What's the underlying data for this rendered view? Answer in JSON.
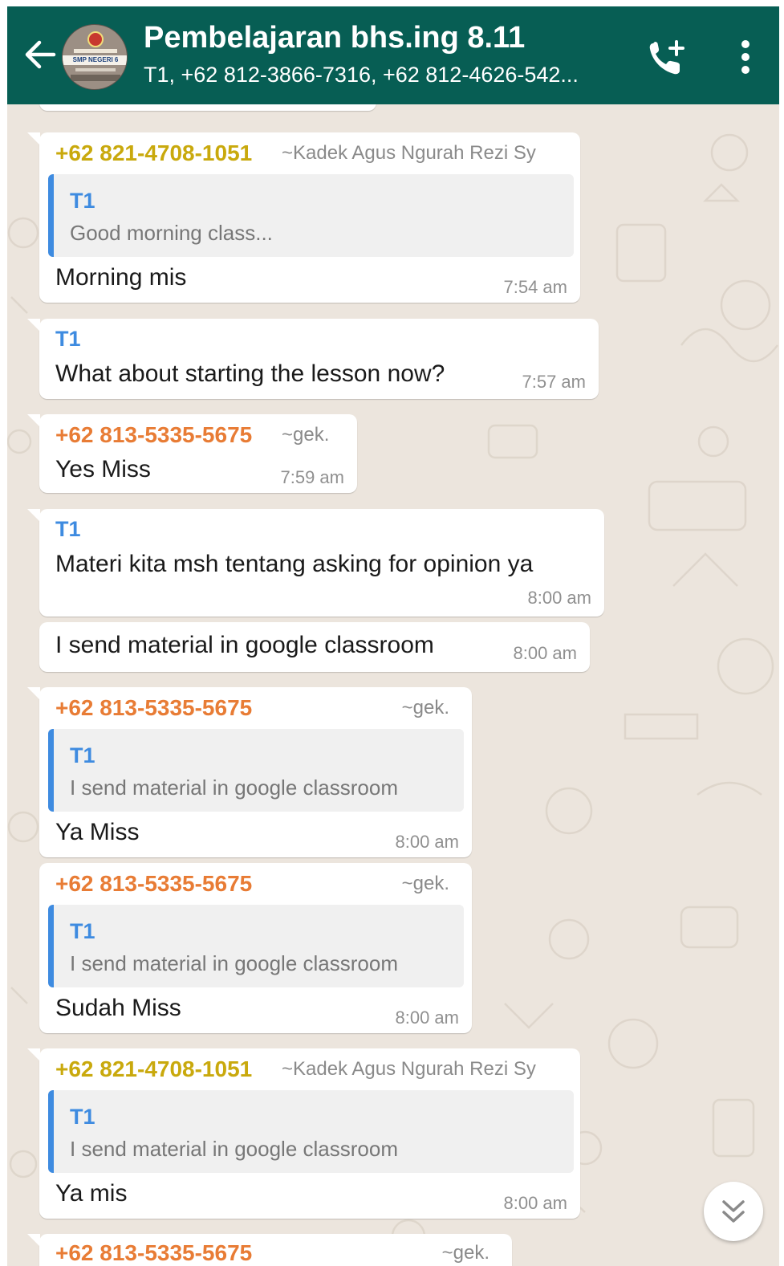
{
  "header": {
    "title": "Pembelajaran bhs.ing 8.11",
    "subtitle": "T1, +62 812-3866-7316, +62 812-4626-542...",
    "avatar_caption": "SMP NEGERI 6",
    "icons": [
      "back-arrow-icon",
      "add-call-icon",
      "more-vert-icon"
    ]
  },
  "colors": {
    "header_bg": "#075e54",
    "chat_bg": "#ece5dd",
    "quote_accent": "#3e8be0",
    "sender_orange": "#e87c35",
    "sender_yellow": "#c9a90d"
  },
  "messages": [
    {
      "sender": "+62 821-4708-1051",
      "alias": "~Kadek Agus Ngurah Rezi Sy",
      "quote": {
        "name": "T1",
        "text": "Good morning class..."
      },
      "text": "Morning mis",
      "time": "7:54 am"
    },
    {
      "name": "T1",
      "text": "What about starting the lesson now?",
      "time": "7:57 am"
    },
    {
      "sender": "+62 813-5335-5675",
      "alias": "~gek.",
      "text": "Yes Miss",
      "time": "7:59 am"
    },
    {
      "name": "T1",
      "text": "Materi kita msh tentang asking for opinion ya",
      "time": "8:00 am"
    },
    {
      "text": "I send material in google classroom",
      "time": "8:00 am"
    },
    {
      "sender": "+62 813-5335-5675",
      "alias": "~gek.",
      "quote": {
        "name": "T1",
        "text": "I send material in google classroom"
      },
      "text": "Ya Miss",
      "time": "8:00 am"
    },
    {
      "sender": "+62 813-5335-5675",
      "alias": "~gek.",
      "quote": {
        "name": "T1",
        "text": "I send material in google classroom"
      },
      "text": "Sudah Miss",
      "time": "8:00 am"
    },
    {
      "sender": "+62 821-4708-1051",
      "alias": "~Kadek Agus Ngurah Rezi Sy",
      "quote": {
        "name": "T1",
        "text": "I send material in google classroom"
      },
      "text": "Ya mis",
      "time": "8:00 am"
    },
    {
      "sender": "+62 813-5335-5675",
      "alias": "~gek."
    }
  ]
}
